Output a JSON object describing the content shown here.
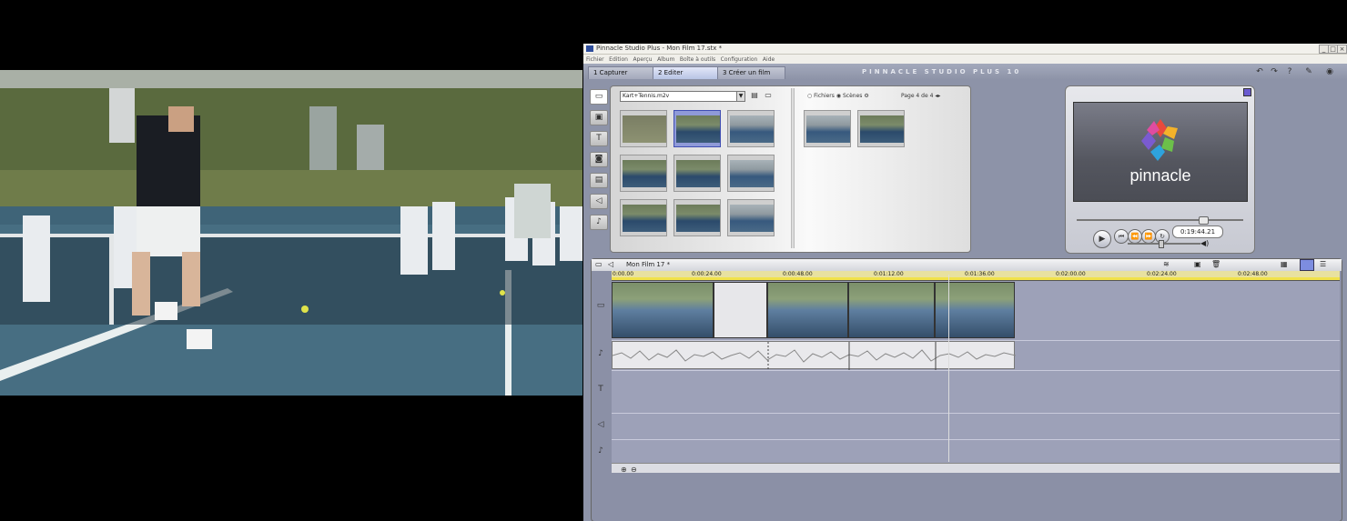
{
  "window": {
    "title": "Pinnacle Studio Plus - Mon Film 17.stx *",
    "controls": [
      "_",
      "□",
      "×"
    ]
  },
  "menu": [
    "Fichier",
    "Edition",
    "Aperçu",
    "Album",
    "Boîte à outils",
    "Configuration",
    "Aide"
  ],
  "mode_tabs": [
    {
      "label": "1  Capturer"
    },
    {
      "label": "2  Editer"
    },
    {
      "label": "3  Créer un film"
    }
  ],
  "brand": "PINNACLE STUDIO PLUS 10",
  "top_icons": [
    "undo-icon",
    "redo-icon",
    "help-icon",
    "info-icon",
    "disc-icon"
  ],
  "album": {
    "file_name": "Kart+Tennis.m2v",
    "view_options": [
      "Fichiers",
      "Scènes"
    ],
    "selected_view": "Scènes",
    "page_info": "Page 4 de 4",
    "side_tabs": [
      "video-icon",
      "transition-icon",
      "title-icon",
      "photo-icon",
      "menu-icon",
      "sound-icon",
      "music-icon"
    ]
  },
  "player": {
    "logo_text": "pinnacle",
    "timecode": "0:19:44.21"
  },
  "timeline": {
    "title": "Mon Film 17 *",
    "ruler_ticks": [
      "0:00.00",
      "0:00:24.00",
      "0:00:48.00",
      "0:01:12.00",
      "0:01:36.00",
      "0:02:00.00",
      "0:02:24.00",
      "0:02:48.00"
    ],
    "track_icons": [
      "video-track-icon",
      "audio-track-icon",
      "title-track-icon",
      "sound-track-icon",
      "music-track-icon"
    ]
  },
  "colors": {
    "app_bg": "#8d93a8",
    "ruler_yellow": "#f1e24a",
    "selection_blue": "#8f9ad8"
  }
}
